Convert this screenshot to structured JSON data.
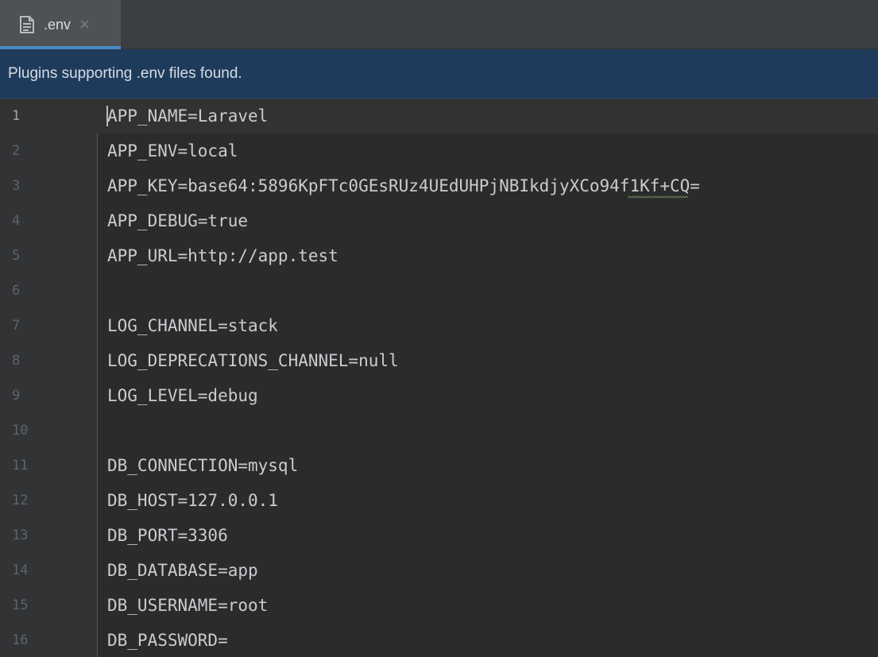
{
  "tab": {
    "label": ".env",
    "icon": "text-file-icon",
    "close_glyph": "×"
  },
  "banner": {
    "text": "Plugins supporting .env files found."
  },
  "editor": {
    "current_line": 1,
    "lines": [
      {
        "number": "1",
        "code": "APP_NAME=Laravel"
      },
      {
        "number": "2",
        "code": "APP_ENV=local"
      },
      {
        "number": "3",
        "code": "APP_KEY=base64:5896KpFTc0GEsRUz4UEdUHPjNBIkdjyXCo94f1Kf+CQ="
      },
      {
        "number": "4",
        "code": "APP_DEBUG=true"
      },
      {
        "number": "5",
        "code": "APP_URL=http://app.test"
      },
      {
        "number": "6",
        "code": ""
      },
      {
        "number": "7",
        "code": "LOG_CHANNEL=stack"
      },
      {
        "number": "8",
        "code": "LOG_DEPRECATIONS_CHANNEL=null"
      },
      {
        "number": "9",
        "code": "LOG_LEVEL=debug"
      },
      {
        "number": "10",
        "code": ""
      },
      {
        "number": "11",
        "code": "DB_CONNECTION=mysql"
      },
      {
        "number": "12",
        "code": "DB_HOST=127.0.0.1"
      },
      {
        "number": "13",
        "code": "DB_PORT=3306"
      },
      {
        "number": "14",
        "code": "DB_DATABASE=app"
      },
      {
        "number": "15",
        "code": "DB_USERNAME=root"
      },
      {
        "number": "16",
        "code": "DB_PASSWORD="
      }
    ]
  },
  "colors": {
    "tab_active_bg": "#4e5254",
    "tab_underline": "#4a88c7",
    "banner_bg": "#1f3b5c",
    "editor_bg": "#2b2b2b",
    "gutter_bg": "#313335",
    "code_text": "#c9ccd0",
    "line_number": "#606366",
    "typo_squiggle": "#6a8759"
  }
}
